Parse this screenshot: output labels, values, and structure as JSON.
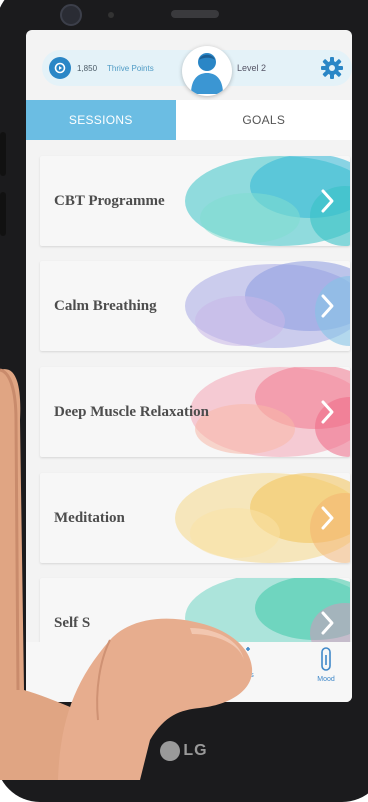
{
  "header": {
    "points_value": "1,850",
    "points_label": "Thrive Points",
    "level": "Level 2",
    "avatar_icon": "user-avatar-icon",
    "settings_icon": "gear-icon",
    "accent_color": "#2a86c6"
  },
  "tabs": [
    {
      "label": "SESSIONS",
      "active": true
    },
    {
      "label": "GOALS",
      "active": false
    }
  ],
  "sessions": [
    {
      "label": "CBT Programme",
      "color": "#3cc5c8"
    },
    {
      "label": "Calm Breathing",
      "color": "#8c9be0"
    },
    {
      "label": "Deep Muscle Relaxation",
      "color": "#f07a90"
    },
    {
      "label": "Meditation",
      "color": "#f2c35a"
    },
    {
      "label": "Self S",
      "color": "#3ec8a8"
    }
  ],
  "bottom_nav": [
    {
      "label": "Activities",
      "icon": "activities-icon"
    },
    {
      "label": "Mood",
      "icon": "thermometer-icon"
    }
  ],
  "device": {
    "brand": "LG"
  }
}
